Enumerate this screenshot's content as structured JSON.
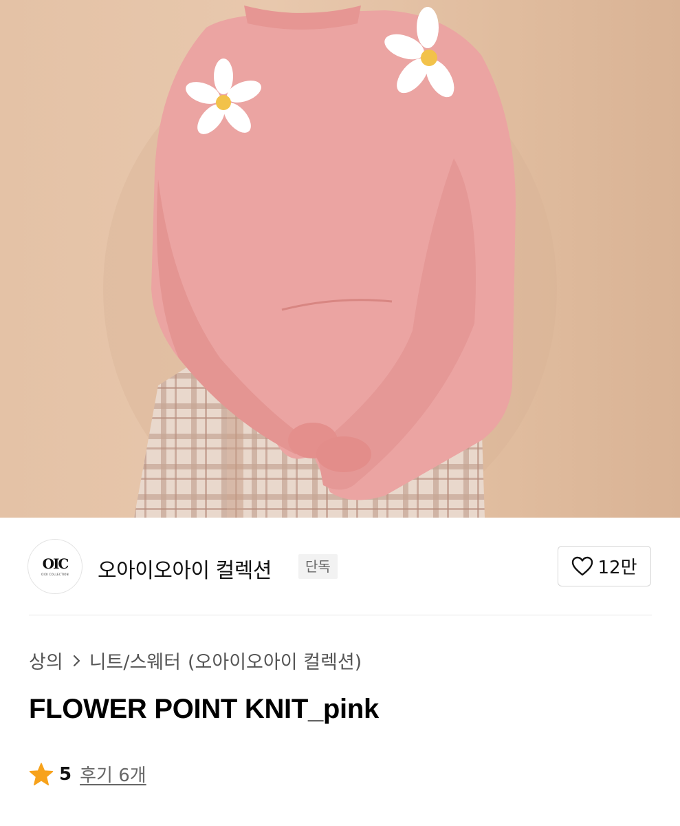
{
  "brand": {
    "logo_mark": "OIC",
    "logo_subtext": "OIOI COLLECTION",
    "name": "오아이오아이 컬렉션",
    "badge": "단독",
    "like_count": "12만"
  },
  "breadcrumb": {
    "category": "상의",
    "subcategory": "니트/스웨터",
    "brand_ref": "(오아이오아이 컬렉션)"
  },
  "product": {
    "title": "FLOWER POINT KNIT_pink",
    "rating": "5",
    "review_link": "후기 6개"
  },
  "colors": {
    "sweater_pink": "#ec9e9e",
    "star": "#f7a21b",
    "background_beige": "#e4c2a6"
  },
  "icons": {
    "like": "heart-outline-icon",
    "breadcrumb_sep": "chevron-right-icon",
    "rating": "star-icon"
  }
}
